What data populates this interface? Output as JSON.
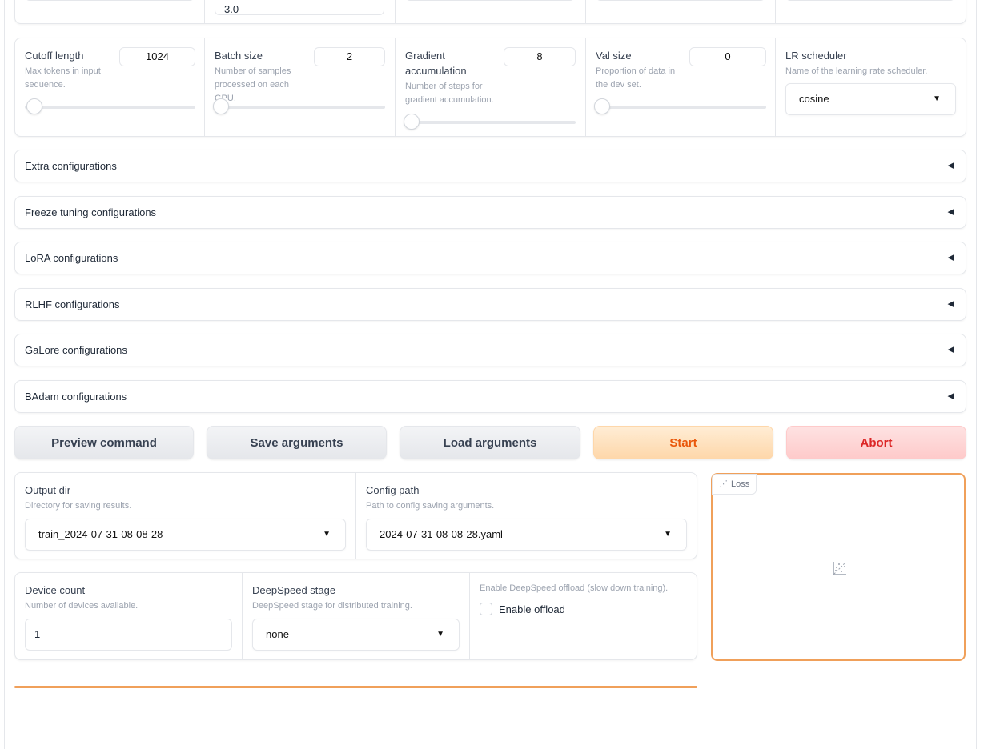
{
  "top_row": {
    "value_2": "3.0"
  },
  "params": [
    {
      "label": "Cutoff length",
      "info": "Max tokens in input sequence.",
      "value": "1024",
      "fraction": 0.0
    },
    {
      "label": "Batch size",
      "info": "Number of samples processed on each GPU.",
      "value": "2",
      "fraction": 0.0
    },
    {
      "label": "Gradient accumulation",
      "info": "Number of steps for gradient accumulation.",
      "value": "8",
      "fraction": 0.0
    },
    {
      "label": "Val size",
      "info": "Proportion of data in the dev set.",
      "value": "0",
      "fraction": 0.0
    }
  ],
  "lr_scheduler": {
    "label": "LR scheduler",
    "info": "Name of the learning rate scheduler.",
    "value": "cosine"
  },
  "accordions": [
    "Extra configurations",
    "Freeze tuning configurations",
    "LoRA configurations",
    "RLHF configurations",
    "GaLore configurations",
    "BAdam configurations"
  ],
  "buttons": {
    "preview": "Preview command",
    "save": "Save arguments",
    "load": "Load arguments",
    "start": "Start",
    "abort": "Abort"
  },
  "output_dir": {
    "label": "Output dir",
    "info": "Directory for saving results.",
    "value": "train_2024-07-31-08-08-28"
  },
  "config_path": {
    "label": "Config path",
    "info": "Path to config saving arguments.",
    "value": "2024-07-31-08-08-28.yaml"
  },
  "device_count": {
    "label": "Device count",
    "info": "Number of devices available.",
    "value": "1"
  },
  "deepspeed": {
    "label": "DeepSpeed stage",
    "info": "DeepSpeed stage for distributed training.",
    "value": "none"
  },
  "offload": {
    "info": "Enable DeepSpeed offload (slow down training).",
    "label": "Enable offload",
    "checked": false
  },
  "loss_plot": {
    "label": "Loss",
    "icon": "chart-scatter-icon"
  },
  "colors": {
    "accent": "#f0a05a",
    "start_bg": "#fed7aa",
    "start_text": "#ea580c",
    "abort_bg": "#fecaca",
    "abort_text": "#dc2626"
  }
}
